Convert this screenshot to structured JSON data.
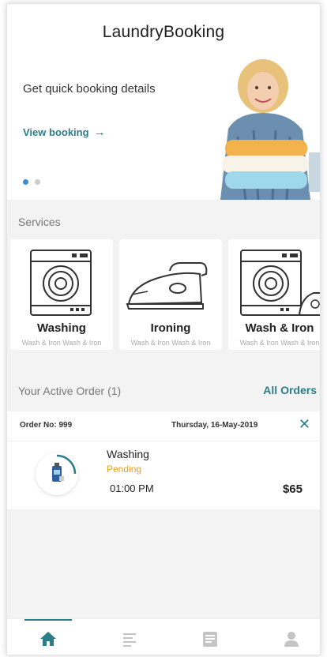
{
  "app": {
    "title": "LaundryBooking"
  },
  "banner": {
    "headline": "Get quick booking details",
    "link_label": "View booking",
    "link_arrow": "→",
    "slides": 2,
    "active_slide": 1
  },
  "services": {
    "title": "Services",
    "items": [
      {
        "name": "Washing",
        "subtitle": "Wash & Iron Wash & Iron",
        "icon": "washing-machine-icon"
      },
      {
        "name": "Ironing",
        "subtitle": "Wash & Iron Wash & Iron",
        "icon": "iron-icon"
      },
      {
        "name": "Wash & Iron",
        "subtitle": "Wash & Iron Wash & Iron",
        "icon": "washing-machine-iron-icon"
      }
    ]
  },
  "active_orders": {
    "title": "Your Active Order (1)",
    "all_orders_label": "All Orders",
    "order": {
      "number": "Order No: 999",
      "date": "Thursday, 16-May-2019",
      "close_icon": "✕",
      "service": "Washing",
      "status": "Pending",
      "time": "01:00 PM",
      "price": "$65"
    }
  },
  "bottom_nav": {
    "items": [
      "home-icon",
      "list-icon",
      "orders-icon",
      "profile-icon"
    ],
    "active": "home-icon"
  },
  "colors": {
    "accent": "#2b7e88",
    "pending": "#e6a31a",
    "dot_active": "#3a8dd6",
    "band": "#f3f3f3"
  }
}
